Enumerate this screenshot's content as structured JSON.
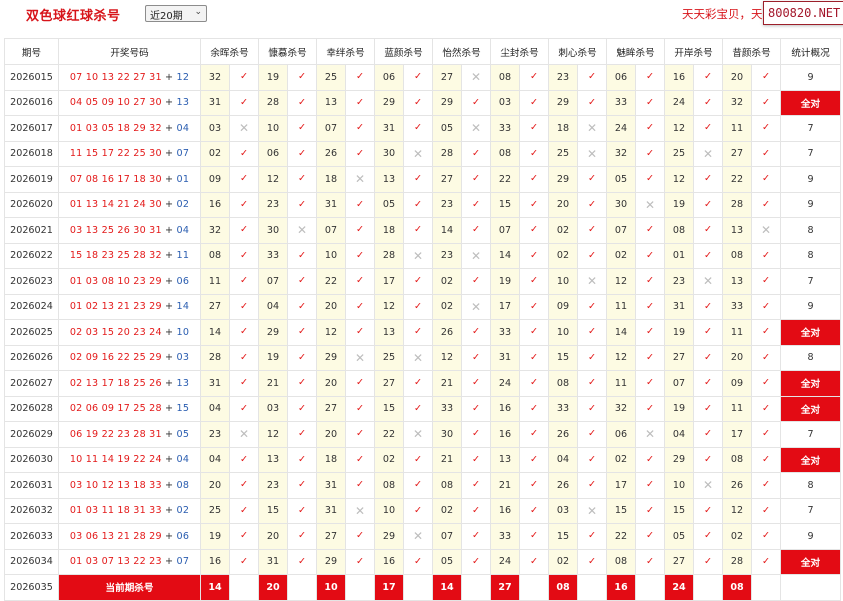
{
  "header": {
    "title": "双色球红球杀号",
    "period_select": "近20期",
    "promo_text": "天天彩宝贝，天",
    "site_badge": "800820.NET"
  },
  "columns": [
    "期号",
    "开奖号码",
    "余晖杀号",
    "慷慕杀号",
    "幸绊杀号",
    "蓝颜杀号",
    "怡然杀号",
    "尘封杀号",
    "刺心杀号",
    "魅眸杀号",
    "开岸杀号",
    "昔颜杀号",
    "统计概况"
  ],
  "rows": [
    {
      "issue": "2026015",
      "reds": "07 10 13 22 27 31",
      "blue": "12",
      "kills": [
        {
          "n": "32",
          "hit": true
        },
        {
          "n": "19",
          "hit": true
        },
        {
          "n": "25",
          "hit": true
        },
        {
          "n": "06",
          "hit": true
        },
        {
          "n": "27",
          "hit": false
        },
        {
          "n": "08",
          "hit": true
        },
        {
          "n": "23",
          "hit": true
        },
        {
          "n": "06",
          "hit": true
        },
        {
          "n": "16",
          "hit": true
        },
        {
          "n": "20",
          "hit": true
        }
      ],
      "stat": "9",
      "full": false
    },
    {
      "issue": "2026016",
      "reds": "04 05 09 10 27 30",
      "blue": "13",
      "kills": [
        {
          "n": "31",
          "hit": true
        },
        {
          "n": "28",
          "hit": true
        },
        {
          "n": "13",
          "hit": true
        },
        {
          "n": "29",
          "hit": true
        },
        {
          "n": "29",
          "hit": true
        },
        {
          "n": "03",
          "hit": true
        },
        {
          "n": "29",
          "hit": true
        },
        {
          "n": "33",
          "hit": true
        },
        {
          "n": "24",
          "hit": true
        },
        {
          "n": "32",
          "hit": true
        }
      ],
      "stat": "全对",
      "full": true
    },
    {
      "issue": "2026017",
      "reds": "01 03 05 18 29 32",
      "blue": "04",
      "kills": [
        {
          "n": "03",
          "hit": false
        },
        {
          "n": "10",
          "hit": true
        },
        {
          "n": "07",
          "hit": true
        },
        {
          "n": "31",
          "hit": true
        },
        {
          "n": "05",
          "hit": false
        },
        {
          "n": "33",
          "hit": true
        },
        {
          "n": "18",
          "hit": false
        },
        {
          "n": "24",
          "hit": true
        },
        {
          "n": "12",
          "hit": true
        },
        {
          "n": "11",
          "hit": true
        }
      ],
      "stat": "7",
      "full": false
    },
    {
      "issue": "2026018",
      "reds": "11 15 17 22 25 30",
      "blue": "07",
      "kills": [
        {
          "n": "02",
          "hit": true
        },
        {
          "n": "06",
          "hit": true
        },
        {
          "n": "26",
          "hit": true
        },
        {
          "n": "30",
          "hit": false
        },
        {
          "n": "28",
          "hit": true
        },
        {
          "n": "08",
          "hit": true
        },
        {
          "n": "25",
          "hit": false
        },
        {
          "n": "32",
          "hit": true
        },
        {
          "n": "25",
          "hit": false
        },
        {
          "n": "27",
          "hit": true
        }
      ],
      "stat": "7",
      "full": false
    },
    {
      "issue": "2026019",
      "reds": "07 08 16 17 18 30",
      "blue": "01",
      "kills": [
        {
          "n": "09",
          "hit": true
        },
        {
          "n": "12",
          "hit": true
        },
        {
          "n": "18",
          "hit": false
        },
        {
          "n": "13",
          "hit": true
        },
        {
          "n": "27",
          "hit": true
        },
        {
          "n": "22",
          "hit": true
        },
        {
          "n": "29",
          "hit": true
        },
        {
          "n": "05",
          "hit": true
        },
        {
          "n": "12",
          "hit": true
        },
        {
          "n": "22",
          "hit": true
        }
      ],
      "stat": "9",
      "full": false
    },
    {
      "issue": "2026020",
      "reds": "01 13 14 21 24 30",
      "blue": "02",
      "kills": [
        {
          "n": "16",
          "hit": true
        },
        {
          "n": "23",
          "hit": true
        },
        {
          "n": "31",
          "hit": true
        },
        {
          "n": "05",
          "hit": true
        },
        {
          "n": "23",
          "hit": true
        },
        {
          "n": "15",
          "hit": true
        },
        {
          "n": "20",
          "hit": true
        },
        {
          "n": "30",
          "hit": false
        },
        {
          "n": "19",
          "hit": true
        },
        {
          "n": "28",
          "hit": true
        }
      ],
      "stat": "9",
      "full": false
    },
    {
      "issue": "2026021",
      "reds": "03 13 25 26 30 31",
      "blue": "04",
      "kills": [
        {
          "n": "32",
          "hit": true
        },
        {
          "n": "30",
          "hit": false
        },
        {
          "n": "07",
          "hit": true
        },
        {
          "n": "18",
          "hit": true
        },
        {
          "n": "14",
          "hit": true
        },
        {
          "n": "07",
          "hit": true
        },
        {
          "n": "02",
          "hit": true
        },
        {
          "n": "07",
          "hit": true
        },
        {
          "n": "08",
          "hit": true
        },
        {
          "n": "13",
          "hit": false
        }
      ],
      "stat": "8",
      "full": false
    },
    {
      "issue": "2026022",
      "reds": "15 18 23 25 28 32",
      "blue": "11",
      "kills": [
        {
          "n": "08",
          "hit": true
        },
        {
          "n": "33",
          "hit": true
        },
        {
          "n": "10",
          "hit": true
        },
        {
          "n": "28",
          "hit": false
        },
        {
          "n": "23",
          "hit": false
        },
        {
          "n": "14",
          "hit": true
        },
        {
          "n": "02",
          "hit": true
        },
        {
          "n": "02",
          "hit": true
        },
        {
          "n": "01",
          "hit": true
        },
        {
          "n": "08",
          "hit": true
        }
      ],
      "stat": "8",
      "full": false
    },
    {
      "issue": "2026023",
      "reds": "01 03 08 10 23 29",
      "blue": "06",
      "kills": [
        {
          "n": "11",
          "hit": true
        },
        {
          "n": "07",
          "hit": true
        },
        {
          "n": "22",
          "hit": true
        },
        {
          "n": "17",
          "hit": true
        },
        {
          "n": "02",
          "hit": true
        },
        {
          "n": "19",
          "hit": true
        },
        {
          "n": "10",
          "hit": false
        },
        {
          "n": "12",
          "hit": true
        },
        {
          "n": "23",
          "hit": false
        },
        {
          "n": "13",
          "hit": true
        }
      ],
      "stat": "7",
      "full": false
    },
    {
      "issue": "2026024",
      "reds": "01 02 13 21 23 29",
      "blue": "14",
      "kills": [
        {
          "n": "27",
          "hit": true
        },
        {
          "n": "04",
          "hit": true
        },
        {
          "n": "20",
          "hit": true
        },
        {
          "n": "12",
          "hit": true
        },
        {
          "n": "02",
          "hit": false
        },
        {
          "n": "17",
          "hit": true
        },
        {
          "n": "09",
          "hit": true
        },
        {
          "n": "11",
          "hit": true
        },
        {
          "n": "31",
          "hit": true
        },
        {
          "n": "33",
          "hit": true
        }
      ],
      "stat": "9",
      "full": false
    },
    {
      "issue": "2026025",
      "reds": "02 03 15 20 23 24",
      "blue": "10",
      "kills": [
        {
          "n": "14",
          "hit": true
        },
        {
          "n": "29",
          "hit": true
        },
        {
          "n": "12",
          "hit": true
        },
        {
          "n": "13",
          "hit": true
        },
        {
          "n": "26",
          "hit": true
        },
        {
          "n": "33",
          "hit": true
        },
        {
          "n": "10",
          "hit": true
        },
        {
          "n": "14",
          "hit": true
        },
        {
          "n": "19",
          "hit": true
        },
        {
          "n": "11",
          "hit": true
        }
      ],
      "stat": "全对",
      "full": true
    },
    {
      "issue": "2026026",
      "reds": "02 09 16 22 25 29",
      "blue": "03",
      "kills": [
        {
          "n": "28",
          "hit": true
        },
        {
          "n": "19",
          "hit": true
        },
        {
          "n": "29",
          "hit": false
        },
        {
          "n": "25",
          "hit": false
        },
        {
          "n": "12",
          "hit": true
        },
        {
          "n": "31",
          "hit": true
        },
        {
          "n": "15",
          "hit": true
        },
        {
          "n": "12",
          "hit": true
        },
        {
          "n": "27",
          "hit": true
        },
        {
          "n": "20",
          "hit": true
        }
      ],
      "stat": "8",
      "full": false
    },
    {
      "issue": "2026027",
      "reds": "02 13 17 18 25 26",
      "blue": "13",
      "kills": [
        {
          "n": "31",
          "hit": true
        },
        {
          "n": "21",
          "hit": true
        },
        {
          "n": "20",
          "hit": true
        },
        {
          "n": "27",
          "hit": true
        },
        {
          "n": "21",
          "hit": true
        },
        {
          "n": "24",
          "hit": true
        },
        {
          "n": "08",
          "hit": true
        },
        {
          "n": "11",
          "hit": true
        },
        {
          "n": "07",
          "hit": true
        },
        {
          "n": "09",
          "hit": true
        }
      ],
      "stat": "全对",
      "full": true
    },
    {
      "issue": "2026028",
      "reds": "02 06 09 17 25 28",
      "blue": "15",
      "kills": [
        {
          "n": "04",
          "hit": true
        },
        {
          "n": "03",
          "hit": true
        },
        {
          "n": "27",
          "hit": true
        },
        {
          "n": "15",
          "hit": true
        },
        {
          "n": "33",
          "hit": true
        },
        {
          "n": "16",
          "hit": true
        },
        {
          "n": "33",
          "hit": true
        },
        {
          "n": "32",
          "hit": true
        },
        {
          "n": "19",
          "hit": true
        },
        {
          "n": "11",
          "hit": true
        }
      ],
      "stat": "全对",
      "full": true
    },
    {
      "issue": "2026029",
      "reds": "06 19 22 23 28 31",
      "blue": "05",
      "kills": [
        {
          "n": "23",
          "hit": false
        },
        {
          "n": "12",
          "hit": true
        },
        {
          "n": "20",
          "hit": true
        },
        {
          "n": "22",
          "hit": false
        },
        {
          "n": "30",
          "hit": true
        },
        {
          "n": "16",
          "hit": true
        },
        {
          "n": "26",
          "hit": true
        },
        {
          "n": "06",
          "hit": false
        },
        {
          "n": "04",
          "hit": true
        },
        {
          "n": "17",
          "hit": true
        }
      ],
      "stat": "7",
      "full": false
    },
    {
      "issue": "2026030",
      "reds": "10 11 14 19 22 24",
      "blue": "04",
      "kills": [
        {
          "n": "04",
          "hit": true
        },
        {
          "n": "13",
          "hit": true
        },
        {
          "n": "18",
          "hit": true
        },
        {
          "n": "02",
          "hit": true
        },
        {
          "n": "21",
          "hit": true
        },
        {
          "n": "13",
          "hit": true
        },
        {
          "n": "04",
          "hit": true
        },
        {
          "n": "02",
          "hit": true
        },
        {
          "n": "29",
          "hit": true
        },
        {
          "n": "08",
          "hit": true
        }
      ],
      "stat": "全对",
      "full": true
    },
    {
      "issue": "2026031",
      "reds": "03 10 12 13 18 33",
      "blue": "08",
      "kills": [
        {
          "n": "20",
          "hit": true
        },
        {
          "n": "23",
          "hit": true
        },
        {
          "n": "31",
          "hit": true
        },
        {
          "n": "08",
          "hit": true
        },
        {
          "n": "08",
          "hit": true
        },
        {
          "n": "21",
          "hit": true
        },
        {
          "n": "26",
          "hit": true
        },
        {
          "n": "17",
          "hit": true
        },
        {
          "n": "10",
          "hit": false
        },
        {
          "n": "26",
          "hit": true
        }
      ],
      "stat": "8",
      "full": false
    },
    {
      "issue": "2026032",
      "reds": "01 03 11 18 31 33",
      "blue": "02",
      "kills": [
        {
          "n": "25",
          "hit": true
        },
        {
          "n": "15",
          "hit": true
        },
        {
          "n": "31",
          "hit": false
        },
        {
          "n": "10",
          "hit": true
        },
        {
          "n": "02",
          "hit": true
        },
        {
          "n": "16",
          "hit": true
        },
        {
          "n": "03",
          "hit": false
        },
        {
          "n": "15",
          "hit": true
        },
        {
          "n": "15",
          "hit": true
        },
        {
          "n": "12",
          "hit": true
        }
      ],
      "stat": "7",
      "full": false
    },
    {
      "issue": "2026033",
      "reds": "03 06 13 21 28 29",
      "blue": "06",
      "kills": [
        {
          "n": "19",
          "hit": true
        },
        {
          "n": "20",
          "hit": true
        },
        {
          "n": "27",
          "hit": true
        },
        {
          "n": "29",
          "hit": false
        },
        {
          "n": "07",
          "hit": true
        },
        {
          "n": "33",
          "hit": true
        },
        {
          "n": "15",
          "hit": true
        },
        {
          "n": "22",
          "hit": true
        },
        {
          "n": "05",
          "hit": true
        },
        {
          "n": "02",
          "hit": true
        }
      ],
      "stat": "9",
      "full": false
    },
    {
      "issue": "2026034",
      "reds": "01 03 07 13 22 23",
      "blue": "07",
      "kills": [
        {
          "n": "16",
          "hit": true
        },
        {
          "n": "31",
          "hit": true
        },
        {
          "n": "29",
          "hit": true
        },
        {
          "n": "16",
          "hit": true
        },
        {
          "n": "05",
          "hit": true
        },
        {
          "n": "24",
          "hit": true
        },
        {
          "n": "02",
          "hit": true
        },
        {
          "n": "08",
          "hit": true
        },
        {
          "n": "27",
          "hit": true
        },
        {
          "n": "28",
          "hit": true
        }
      ],
      "stat": "全对",
      "full": true
    }
  ],
  "current": {
    "issue": "2026035",
    "label": "当前期杀号",
    "kills": [
      "14",
      "20",
      "10",
      "17",
      "14",
      "27",
      "08",
      "16",
      "24",
      "08"
    ]
  },
  "marks": {
    "hit": "✓",
    "miss": "✕"
  }
}
